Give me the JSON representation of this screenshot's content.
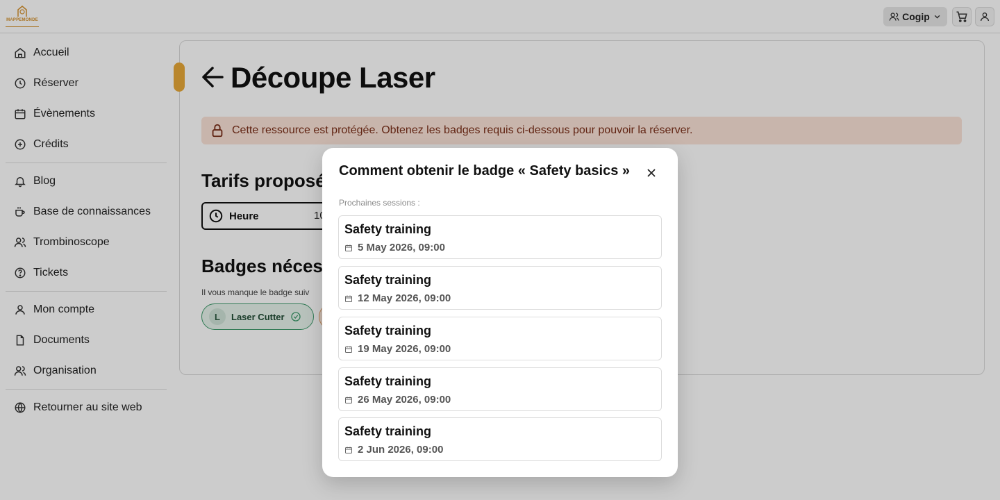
{
  "header": {
    "logo_text": "MAPPEMONDE",
    "org_name": "Cogip"
  },
  "sidebar": {
    "items": [
      {
        "label": "Accueil",
        "icon": "home-icon"
      },
      {
        "label": "Réserver",
        "icon": "clock-icon"
      },
      {
        "label": "Évènements",
        "icon": "calendar-icon"
      },
      {
        "label": "Crédits",
        "icon": "plus-circle-icon"
      },
      {
        "label": "Blog",
        "icon": "bell-icon"
      },
      {
        "label": "Base de connaissances",
        "icon": "coffee-icon"
      },
      {
        "label": "Trombinoscope",
        "icon": "users-icon"
      },
      {
        "label": "Tickets",
        "icon": "help-circle-icon"
      },
      {
        "label": "Mon compte",
        "icon": "user-icon"
      },
      {
        "label": "Documents",
        "icon": "document-icon"
      },
      {
        "label": "Organisation",
        "icon": "users-icon"
      },
      {
        "label": "Retourner au site web",
        "icon": "globe-icon"
      }
    ]
  },
  "main": {
    "title": "Découpe Laser",
    "alert": "Cette ressource est protégée. Obtenez les badges requis ci-dessous pour pouvoir la réserver.",
    "tarifs_title": "Tarifs proposé",
    "tarif_label": "Heure",
    "tarif_price": "10",
    "badges_title": "Badges néces",
    "badges_note": "Il vous manque le badge suiv",
    "badge_letter": "L",
    "badge_name": "Laser Cutter"
  },
  "modal": {
    "title": "Comment obtenir le badge « Safety basics »",
    "sessions_label": "Prochaines sessions :",
    "sessions": [
      {
        "name": "Safety training",
        "date": "5 May 2026, 09:00"
      },
      {
        "name": "Safety training",
        "date": "12 May 2026, 09:00"
      },
      {
        "name": "Safety training",
        "date": "19 May 2026, 09:00"
      },
      {
        "name": "Safety training",
        "date": "26 May 2026, 09:00"
      },
      {
        "name": "Safety training",
        "date": "2 Jun 2026, 09:00"
      }
    ]
  },
  "colors": {
    "accent": "#e8a838",
    "alert_bg": "#fbe3d7",
    "badge_green": "#3e9a6b"
  }
}
